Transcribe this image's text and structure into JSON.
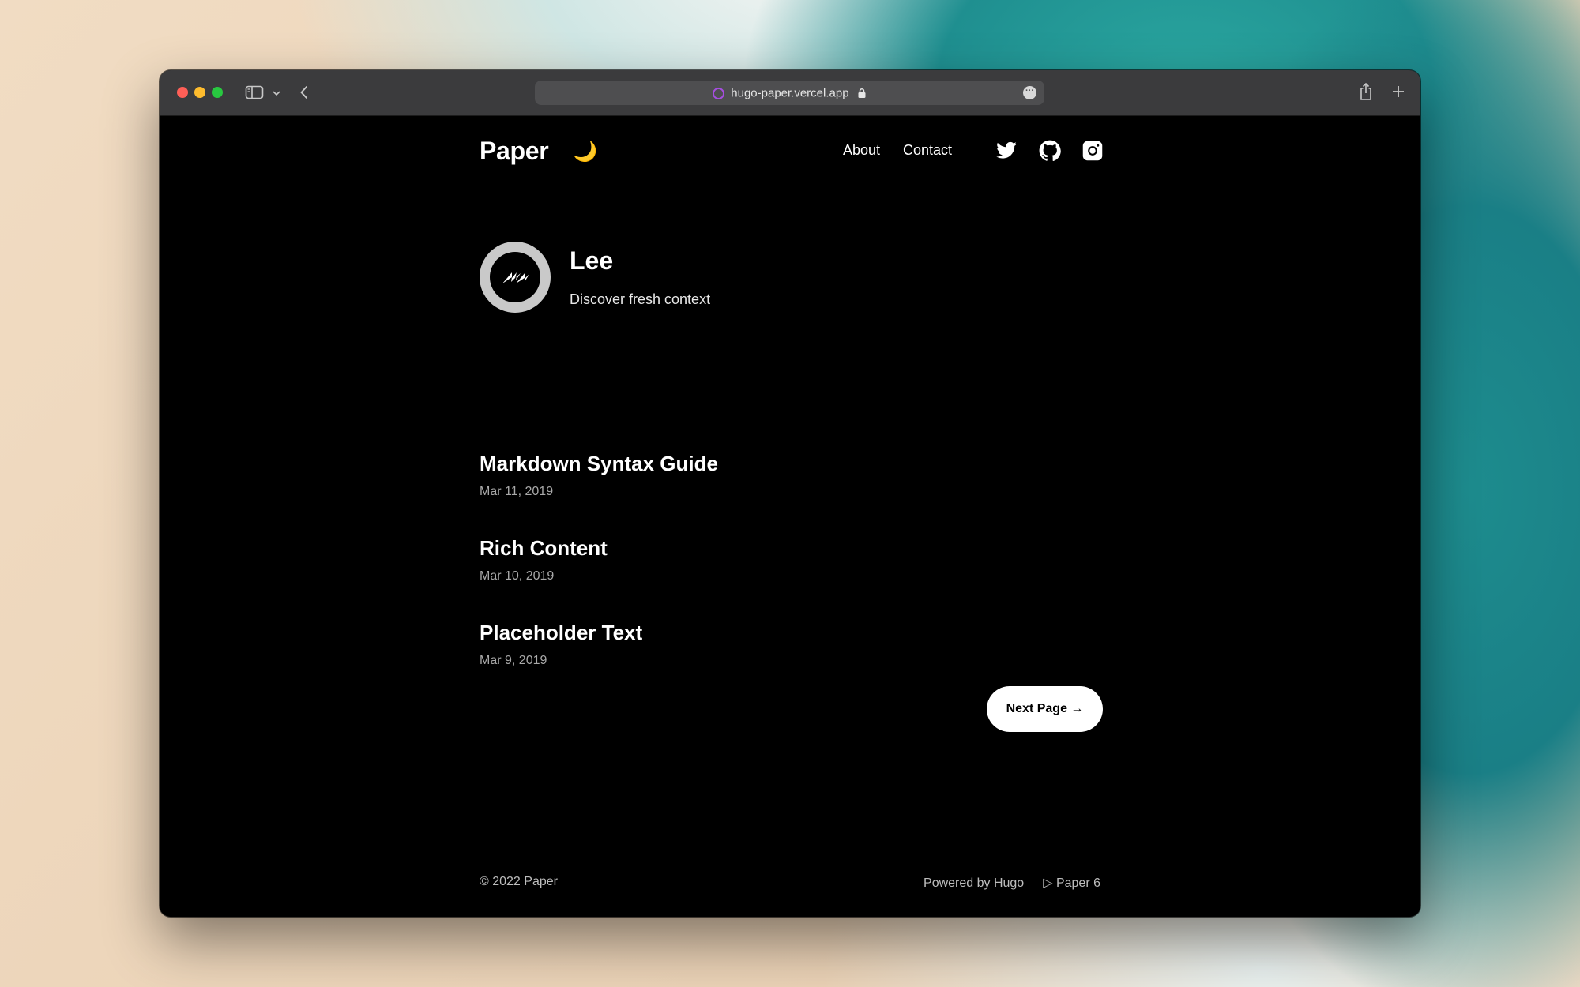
{
  "browser": {
    "url": "hugo-paper.vercel.app",
    "traffic_lights": [
      "close",
      "minimize",
      "zoom"
    ],
    "icons": [
      "sidebar-icon",
      "chevron-down-icon",
      "back-icon",
      "site-icon",
      "lock-icon",
      "more-icon",
      "share-icon",
      "new-tab-icon"
    ]
  },
  "header": {
    "logo": "Paper",
    "theme_toggle": "🌙",
    "nav": [
      {
        "label": "About"
      },
      {
        "label": "Contact"
      }
    ],
    "social_icons": [
      "twitter-icon",
      "github-icon",
      "instagram-icon"
    ]
  },
  "profile": {
    "name": "Lee",
    "bio": "Discover fresh context"
  },
  "posts": [
    {
      "title": "Markdown Syntax Guide",
      "date": "Mar 11, 2019"
    },
    {
      "title": "Rich Content",
      "date": "Mar 10, 2019"
    },
    {
      "title": "Placeholder Text",
      "date": "Mar 9, 2019"
    }
  ],
  "pagination": {
    "next_label": "Next Page →"
  },
  "footer": {
    "copyright": "© 2022 Paper",
    "powered_by": "Powered by Hugo",
    "theme": "▷ Paper 6"
  },
  "colors": {
    "page_background": "#000000",
    "text": "#ffffff",
    "muted_text": "#a8a8a8",
    "moon": "#f5c93a",
    "button_background": "#ffffff"
  }
}
